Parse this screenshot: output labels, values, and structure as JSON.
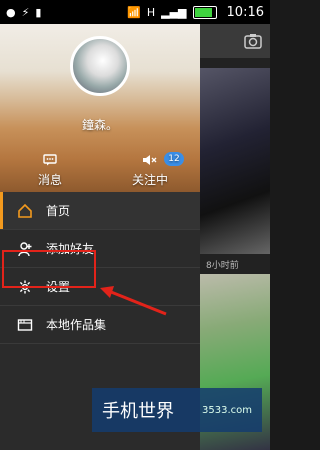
{
  "statusbar": {
    "time": "10:16",
    "h_icon": "H",
    "battery_level": 0.9
  },
  "header": {
    "username": "鐘森。",
    "actions": [
      {
        "label": "消息",
        "icon": "message-icon"
      },
      {
        "label": "关注中",
        "icon": "bell-icon",
        "badge": "12"
      }
    ]
  },
  "menu": {
    "items": [
      {
        "label": "首页",
        "icon": "home-icon",
        "active": true
      },
      {
        "label": "添加好友",
        "icon": "add-friend-icon"
      },
      {
        "label": "设置",
        "icon": "gear-icon"
      },
      {
        "label": "本地作品集",
        "icon": "folder-icon"
      }
    ]
  },
  "content": {
    "timestamp": "8小时前"
  },
  "watermark": {
    "title": "手机世界",
    "subtitle": "3533.com"
  },
  "colors": {
    "accent": "#f39a1e",
    "badge": "#3a8ee6",
    "highlight": "#e2231a"
  }
}
